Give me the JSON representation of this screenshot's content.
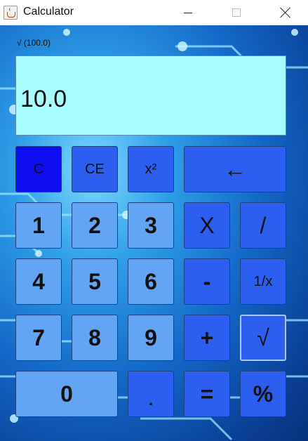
{
  "window": {
    "title": "Calculator",
    "app_icon": "java-cup-icon"
  },
  "display": {
    "formula": "√ (100.0)",
    "value": "10.0"
  },
  "keys": {
    "c": "C",
    "ce": "CE",
    "square": "x²",
    "backspace": "←",
    "one": "1",
    "two": "2",
    "three": "3",
    "multiply": "X",
    "divide": "/",
    "four": "4",
    "five": "5",
    "six": "6",
    "subtract": "-",
    "reciprocal": "1/x",
    "seven": "7",
    "eight": "8",
    "nine": "9",
    "add": "+",
    "sqrt": "√",
    "zero": "0",
    "decimal": ".",
    "equals": "=",
    "percent": "%"
  },
  "colors": {
    "display_bg": "#a7fcff",
    "key_light": "#62a5f5",
    "key_mid": "#2c5ef0",
    "key_dark": "#0d0ff0"
  }
}
